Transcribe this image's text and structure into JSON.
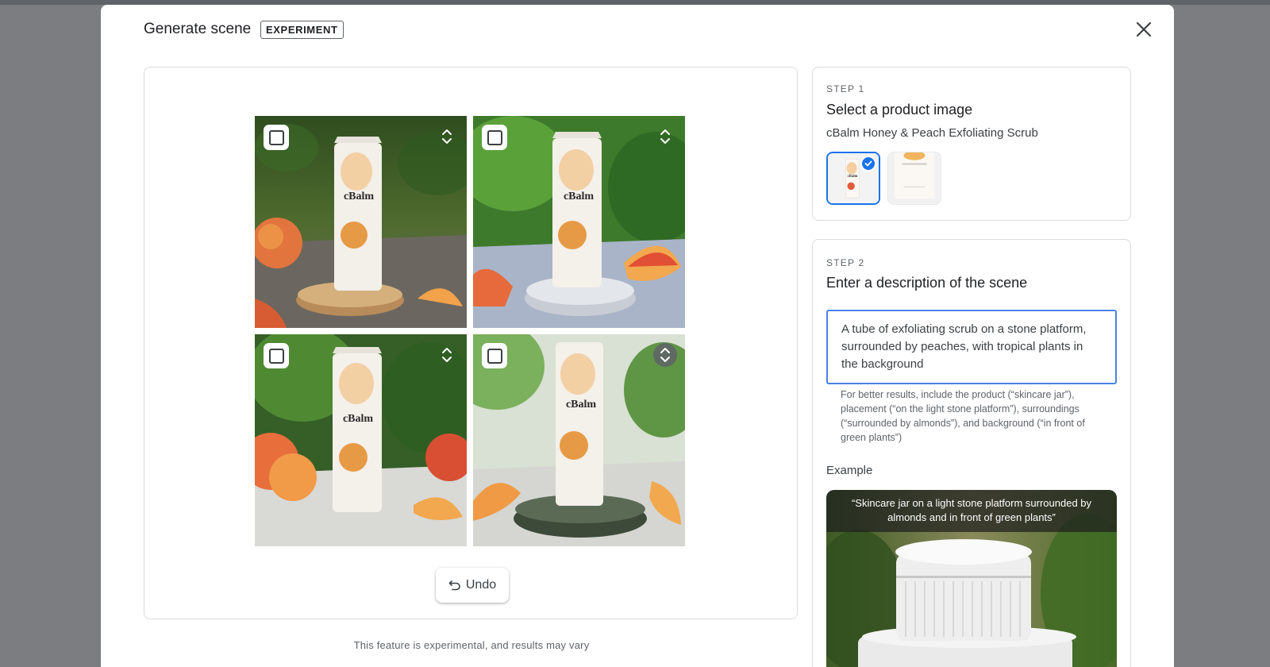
{
  "dialog": {
    "title": "Generate scene",
    "badge": "EXPERIMENT",
    "close_icon": "close-icon"
  },
  "generated_images": [
    {
      "alt": "cBalm tube on wooden slab with peaches",
      "checked": false,
      "expand_icon": "chevron-up-down-icon"
    },
    {
      "alt": "cBalm tube on white stone with peach slices",
      "checked": false,
      "expand_icon": "chevron-up-down-icon"
    },
    {
      "alt": "cBalm tube beside peaches on stone surface",
      "checked": false,
      "expand_icon": "chevron-up-down-icon"
    },
    {
      "alt": "cBalm tube on green stone with peach slices",
      "checked": false,
      "expand_icon": "chevron-up-down-icon"
    }
  ],
  "undo": {
    "label": "Undo",
    "icon": "undo-icon"
  },
  "footnote": "This feature is experimental, and results may vary",
  "step1": {
    "label": "STEP 1",
    "title": "Select a product image",
    "product_name": "cBalm Honey & Peach Exfoliating Scrub",
    "thumbnails": [
      {
        "selected": true
      },
      {
        "selected": false
      }
    ]
  },
  "step2": {
    "label": "STEP 2",
    "title": "Enter a description of the scene",
    "description_value": "A tube of exfoliating scrub on a stone platform, surrounded by peaches, with tropical plants in the background",
    "hint": "For better results, include the product (“skincare jar”), placement (“on the light stone platform”), surroundings (“surrounded by almonds”), and background (“in front of green plants”)",
    "example_label": "Example",
    "example_caption": "“Skincare jar on a light stone platform surrounded by almonds and in front of green plants”"
  },
  "product": {
    "brand": "cBalm"
  },
  "colors": {
    "accent": "#1a73e8",
    "overlay": "#7b7d80"
  }
}
